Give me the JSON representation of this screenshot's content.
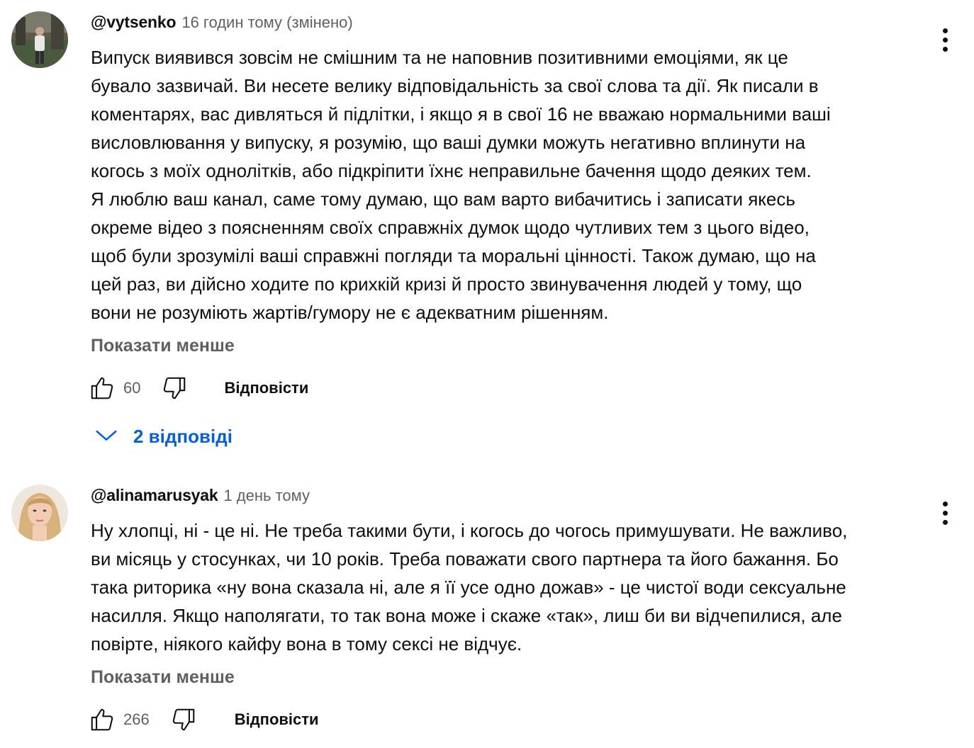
{
  "comments": [
    {
      "author": "@vytsenko",
      "time": "16 годин тому (змінено)",
      "lines": [
        "Випуск виявився зовсім не смішним та не наповнив позитивними емоціями, як це",
        "бувало зазвичай. Ви несете велику відповідальність за свої слова та дії. Як писали в",
        "коментарях, вас дивляться й підлітки, і якщо я в свої 16 не вважаю нормальними ваші",
        "висловлювання у випуску, я розумію, що ваші думки можуть негативно вплинути на",
        "когось з моїх однолітків, або підкріпити їхнє неправильне бачення щодо деяких тем.",
        "Я люблю ваш канал, саме тому думаю, що вам варто вибачитись і записати якесь",
        "окреме відео з поясненням своїх справжніх думок щодо чутливих тем з цього відео,",
        "щоб були зрозумілі ваші справжні погляди та моральні цінності.  Також думаю, що на",
        "цей раз, ви дійсно ходите по крихкій кризі й просто звинувачення людей у тому, що",
        "вони не розуміють жартів/гумору не є адекватним рішенням."
      ],
      "show_less": "Показати менше",
      "likes": "60",
      "reply_label": "Відповісти",
      "replies_label": "2 відповіді"
    },
    {
      "author": "@alinamarusyak",
      "time": "1 день тому",
      "lines": [
        "Ну хлопці, ні - це ні. Не треба такими бути, і когось до чогось примушувати. Не важливо,",
        "ви місяць у стосунках, чи 10 років. Треба поважати свого партнера та його бажання. Бо",
        "така риторика «ну вона сказала ні, але я її усе одно дожав» - це чистої води сексуальне",
        "насилля. Якщо наполягати, то так вона може і скаже «так», лиш би ви відчепилися, але",
        "повірте, ніякого кайфу вона в тому сексі не відчує."
      ],
      "show_less": "Показати менше",
      "likes": "266",
      "reply_label": "Відповісти"
    }
  ],
  "icons": {
    "like": "thumb-up-icon",
    "dislike": "thumb-down-icon",
    "more": "more-vert-icon",
    "expand": "chevron-down-icon"
  },
  "colors": {
    "text": "#0f0f0f",
    "secondary": "#606060",
    "link": "#065fd4"
  }
}
